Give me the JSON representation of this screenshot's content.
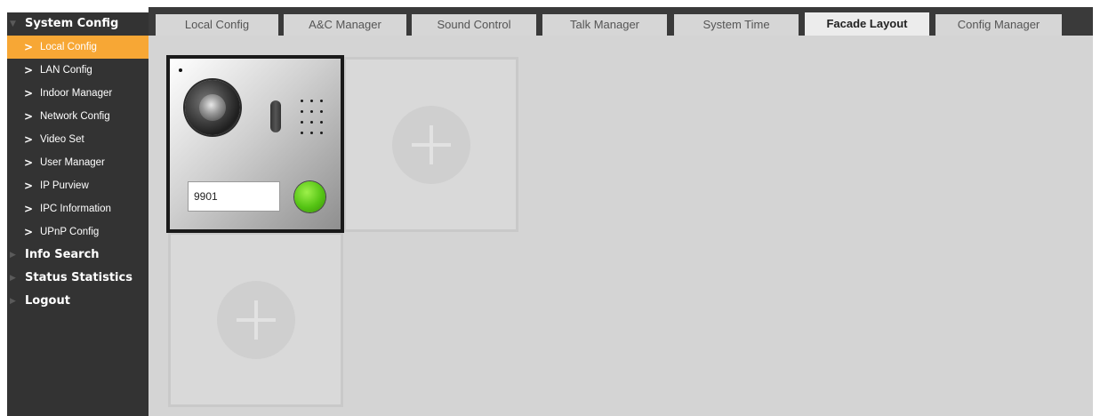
{
  "sidebar": {
    "groups": [
      {
        "label": "System Config",
        "expanded": true,
        "items": [
          {
            "label": "Local Config",
            "active": true
          },
          {
            "label": "LAN Config"
          },
          {
            "label": "Indoor Manager"
          },
          {
            "label": "Network Config"
          },
          {
            "label": "Video Set"
          },
          {
            "label": "User Manager"
          },
          {
            "label": "IP Purview"
          },
          {
            "label": "IPC Information"
          },
          {
            "label": "UPnP Config"
          }
        ]
      },
      {
        "label": "Info Search",
        "expanded": false
      },
      {
        "label": "Status Statistics",
        "expanded": false
      },
      {
        "label": "Logout",
        "expanded": false
      }
    ]
  },
  "tabs": [
    {
      "label": "Local Config"
    },
    {
      "label": "A&C Manager"
    },
    {
      "label": "Sound Control"
    },
    {
      "label": "Talk Manager"
    },
    {
      "label": "System Time"
    },
    {
      "label": "Facade Layout",
      "active": true
    },
    {
      "label": "Config Manager"
    }
  ],
  "facade": {
    "device_number": "9901",
    "add_icon": "plus-icon"
  },
  "colors": {
    "sidebar_bg": "#333333",
    "active_item": "#f7a735",
    "tabbar_bg": "#3a3a3a",
    "main_bg": "#d4d4d4",
    "call_button": "#55c414"
  }
}
